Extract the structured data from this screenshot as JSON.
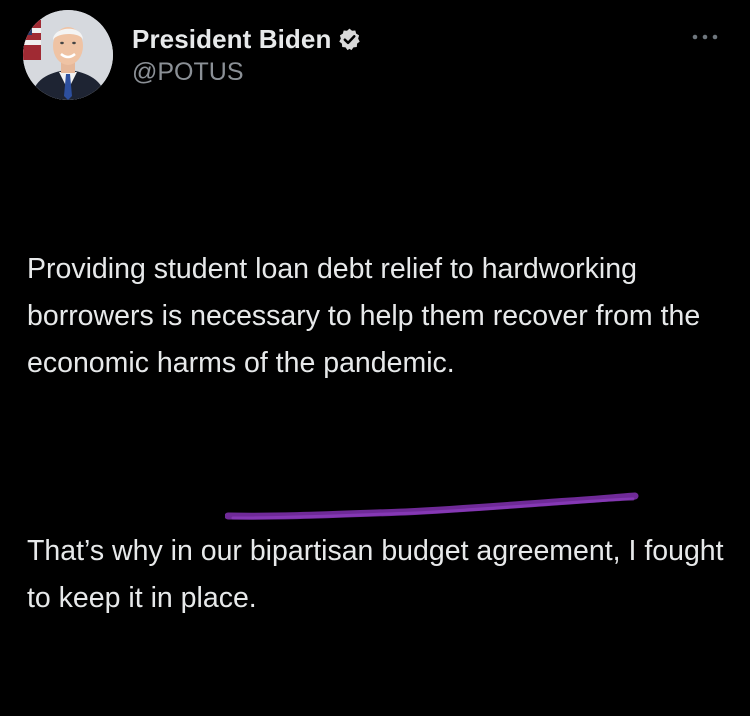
{
  "author": {
    "display_name": "President Biden",
    "handle": "@POTUS",
    "verified": true,
    "avatar_icon": "profile-photo-avatar",
    "verified_icon": "verified-badge-icon"
  },
  "tweet": {
    "paragraphs": [
      "Providing student loan debt relief to hardworking borrowers is necessary to help them recover from the economic harms of the pandemic.",
      "That’s why in our bipartisan budget agreement, I fought to keep it in place."
    ]
  },
  "menu": {
    "icon": "more-options-icon"
  },
  "annotation": {
    "type": "hand-drawn-underline",
    "color": "#7b2fa8"
  },
  "colors": {
    "background": "#000000",
    "primary_text": "#e7e9ea",
    "secondary_text": "#8b9096"
  }
}
